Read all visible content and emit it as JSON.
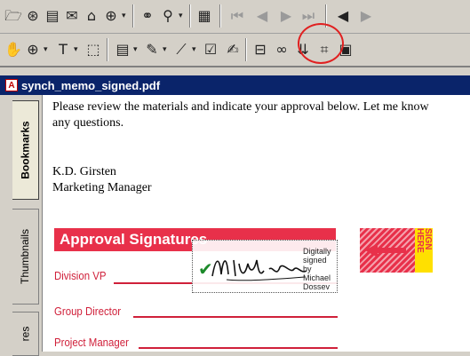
{
  "document": {
    "filename": "synch_memo_signed.pdf",
    "body_line1": "Please review the materials and indicate your approval below. Let me know",
    "body_line2": "any questions.",
    "author_name": "K.D. Girsten",
    "author_title": "Marketing Manager",
    "approval_heading": "Approval Signatures",
    "signature_rows": [
      {
        "label": "Division VP"
      },
      {
        "label": "Group Director"
      },
      {
        "label": "Project Manager"
      }
    ],
    "signature_field": {
      "handwritten_name": "Michael Dossev",
      "digital_signature_text": "Digitally signed by Michael Dossev"
    },
    "sign_here_text": "SIGN HERE"
  },
  "sidebar": {
    "tabs": [
      "Bookmarks",
      "Thumbnails",
      "res"
    ],
    "active_tab": "Bookmarks"
  },
  "toolbar_row1": [
    "open-folder-icon",
    "save-icon",
    "print-icon",
    "email-icon",
    "search-web-icon",
    "binoculars-icon",
    "find-icon",
    "show-pane-icon",
    "first-page-icon",
    "previous-page-icon",
    "next-page-icon",
    "last-page-icon",
    "go-back-icon"
  ],
  "toolbar_row2": [
    "hand-tool-icon",
    "zoom-icon",
    "text-select-icon",
    "graphics-select-icon",
    "notes-icon",
    "pencil-icon",
    "highlight-icon",
    "spell-check-icon",
    "digital-signature-icon",
    "form-field-icon",
    "link-icon",
    "article-icon",
    "crop-icon",
    "touchup-icon"
  ],
  "colors": {
    "accent_red": "#e8304a",
    "title_bar": "#0a246a",
    "sign_tag_yellow": "#ffe000",
    "check_green": "#1c8a2a"
  }
}
